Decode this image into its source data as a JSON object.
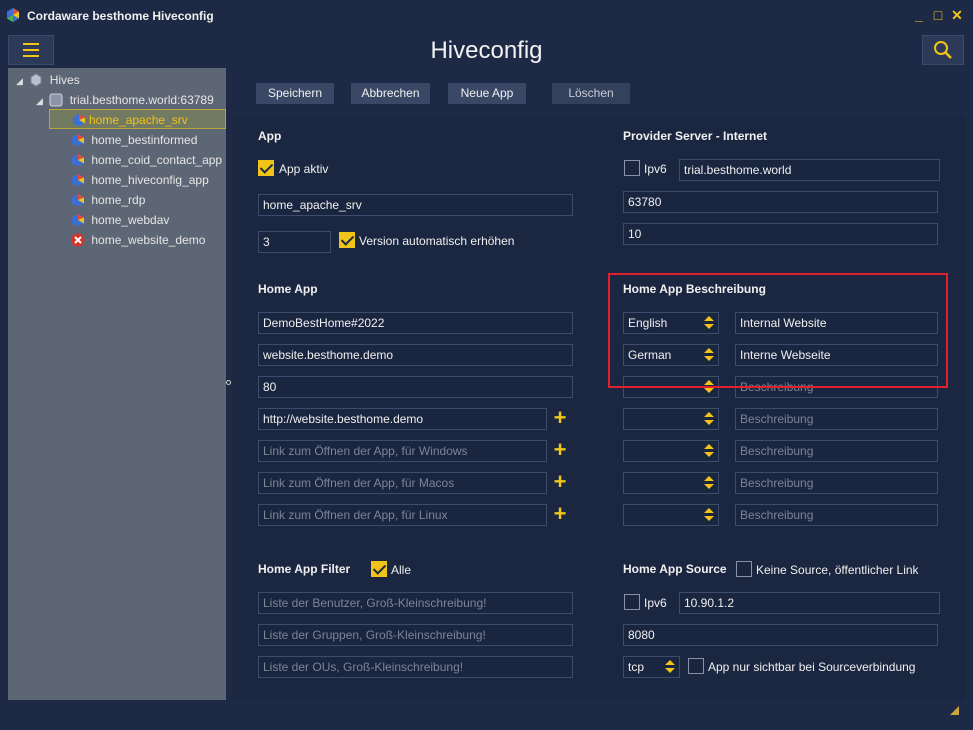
{
  "window": {
    "title": "Cordaware besthome Hiveconfig",
    "controls": [
      "_",
      "□",
      "✕"
    ]
  },
  "header": {
    "title": "Hiveconfig"
  },
  "tree": {
    "root": "Hives",
    "server": "trial.besthome.world:63789",
    "apps": [
      "home_apache_srv",
      "home_bestinformed",
      "home_coid_contact_app",
      "home_hiveconfig_app",
      "home_rdp",
      "home_webdav",
      "home_website_demo"
    ]
  },
  "toolbar": {
    "save": "Speichern",
    "cancel": "Abbrechen",
    "new_app": "Neue App",
    "delete": "Löschen"
  },
  "app": {
    "section": "App",
    "active_label": "App aktiv",
    "name": "home_apache_srv",
    "version": "3",
    "auto_version_label": "Version automatisch erhöhen"
  },
  "provider": {
    "section": "Provider Server - Internet",
    "ipv6_label": "Ipv6",
    "host": "trial.besthome.world",
    "port": "63780",
    "value3": "10"
  },
  "home_app": {
    "section": "Home App",
    "id": "DemoBestHome#2022",
    "domain": "website.besthome.demo",
    "port": "80",
    "url": "http://website.besthome.demo",
    "link_windows_ph": "Link zum Öffnen der App, für Windows",
    "link_macos_ph": "Link zum Öffnen der App, für Macos",
    "link_linux_ph": "Link zum Öffnen der App, für Linux"
  },
  "description": {
    "section": "Home App Beschreibung",
    "lang1": "English",
    "text1": "Internal Website",
    "lang2": "German",
    "text2": "Interne Webseite",
    "placeholder": "Beschreibung"
  },
  "filter": {
    "section": "Home App Filter",
    "all_label": "Alle",
    "users_ph": "Liste der Benutzer, Groß-Kleinschreibung!",
    "groups_ph": "Liste der Gruppen, Groß-Kleinschreibung!",
    "ous_ph": "Liste der OUs, Groß-Kleinschreibung!"
  },
  "source": {
    "section": "Home App Source",
    "no_source_label": "Keine Source, öffentlicher Link",
    "ipv6_label": "Ipv6",
    "ip": "10.90.1.2",
    "port": "8080",
    "protocol": "tcp",
    "visible_label": "App nur sichtbar bei Sourceverbindung"
  },
  "colors": {
    "accent": "#f0c419",
    "background": "#1e2a45",
    "sidebar": "#5d6675",
    "highlight": "#e0202a"
  }
}
